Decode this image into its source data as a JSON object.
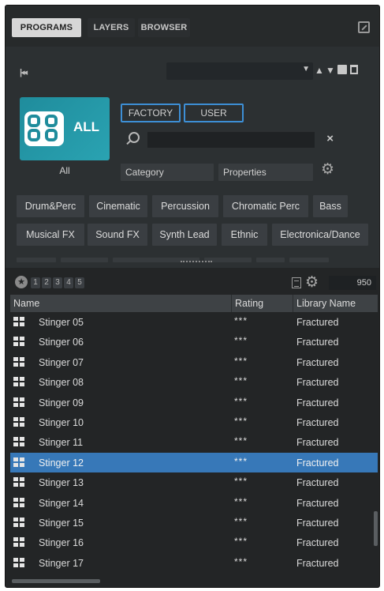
{
  "tabs": [
    {
      "label": "PROGRAMS",
      "active": true
    },
    {
      "label": "LAYERS",
      "active": false
    },
    {
      "label": "BROWSER",
      "active": false
    }
  ],
  "filter": {
    "library_name": "ALL",
    "library_caption": "All",
    "factory_label": "FACTORY",
    "user_label": "USER",
    "search_value": "",
    "search_placeholder": "",
    "clear_glyph": "×",
    "category_label": "Category",
    "properties_label": "Properties"
  },
  "tags": [
    "Drum&Perc",
    "Cinematic",
    "Percussion",
    "Chromatic Perc",
    "Bass",
    "Musical FX",
    "Sound FX",
    "Synth Lead",
    "Ethnic",
    "Electronica/Dance"
  ],
  "rating_filter": {
    "levels": [
      "1",
      "2",
      "3",
      "4",
      "5"
    ],
    "result_count": "950"
  },
  "table": {
    "columns": [
      "Name",
      "Rating",
      "Library Name"
    ],
    "rows": [
      {
        "name": "Stinger 05",
        "rating": "***",
        "library": "Fractured",
        "selected": false
      },
      {
        "name": "Stinger 06",
        "rating": "***",
        "library": "Fractured",
        "selected": false
      },
      {
        "name": "Stinger 07",
        "rating": "***",
        "library": "Fractured",
        "selected": false
      },
      {
        "name": "Stinger 08",
        "rating": "***",
        "library": "Fractured",
        "selected": false
      },
      {
        "name": "Stinger 09",
        "rating": "***",
        "library": "Fractured",
        "selected": false
      },
      {
        "name": "Stinger 10",
        "rating": "***",
        "library": "Fractured",
        "selected": false
      },
      {
        "name": "Stinger 11",
        "rating": "***",
        "library": "Fractured",
        "selected": false
      },
      {
        "name": "Stinger 12",
        "rating": "***",
        "library": "Fractured",
        "selected": true
      },
      {
        "name": "Stinger 13",
        "rating": "***",
        "library": "Fractured",
        "selected": false
      },
      {
        "name": "Stinger 14",
        "rating": "***",
        "library": "Fractured",
        "selected": false
      },
      {
        "name": "Stinger 15",
        "rating": "***",
        "library": "Fractured",
        "selected": false
      },
      {
        "name": "Stinger 16",
        "rating": "***",
        "library": "Fractured",
        "selected": false
      },
      {
        "name": "Stinger 17",
        "rating": "***",
        "library": "Fractured",
        "selected": false
      }
    ]
  },
  "icons": {
    "previous": "skip-previous-icon",
    "dropdown": "chevron-down-icon",
    "load_prev": "arrow-up-icon",
    "load_next": "arrow-down-icon",
    "save": "save-icon",
    "delete": "trash-icon",
    "search": "search-icon",
    "settings": "gear-icon",
    "rating": "star-icon",
    "view_options": "view-options-icon",
    "program_row": "program-icon",
    "detach": "detach-window-icon"
  },
  "colors": {
    "panel_bg": "#232526",
    "accent_blue": "#3d8fd6",
    "selection_blue": "#3778b8",
    "logo_teal": "#1f8c9c"
  }
}
